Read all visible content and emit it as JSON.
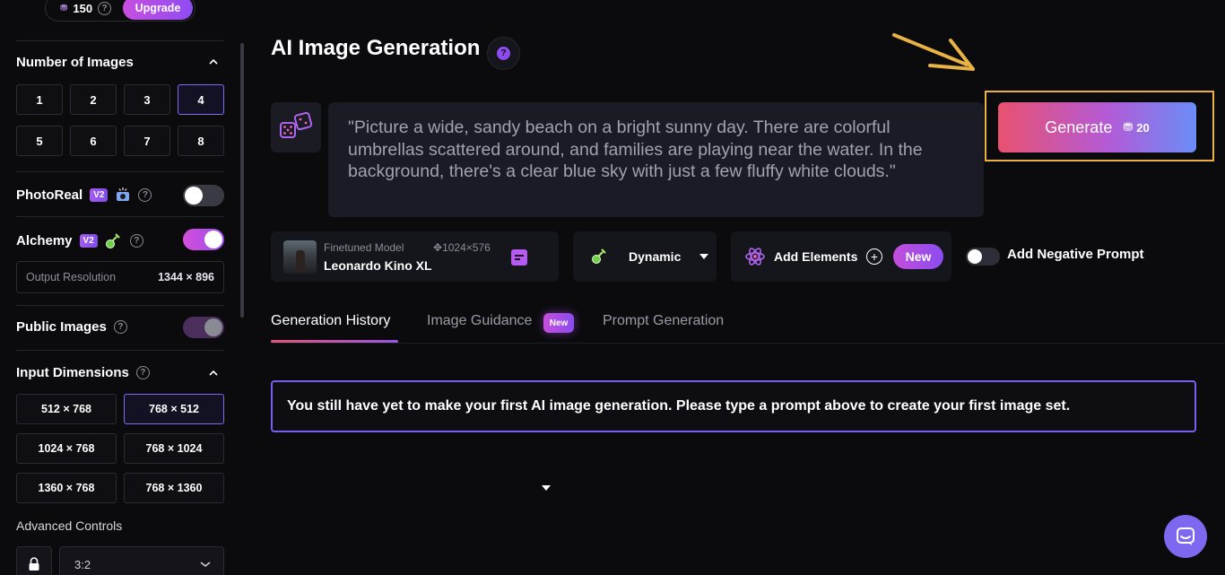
{
  "sidebar": {
    "credits": "150",
    "upgrade_label": "Upgrade",
    "number_of_images": {
      "title": "Number of Images",
      "options": [
        "1",
        "2",
        "3",
        "4",
        "5",
        "6",
        "7",
        "8"
      ],
      "selected": "4"
    },
    "photoreal": {
      "label": "PhotoReal",
      "badge": "V2",
      "enabled": false
    },
    "alchemy": {
      "label": "Alchemy",
      "badge": "V2",
      "enabled": true
    },
    "output_resolution": {
      "label": "Output Resolution",
      "value": "1344 × 896"
    },
    "public_images": {
      "label": "Public Images",
      "enabled": true
    },
    "input_dimensions": {
      "title": "Input Dimensions",
      "options": [
        "512 × 768",
        "768 × 512",
        "1024 × 768",
        "768 × 1024",
        "1360 × 768",
        "768 × 1360"
      ],
      "selected": "768 × 512"
    },
    "advanced_controls": {
      "label": "Advanced Controls",
      "aspect_ratio": "3:2"
    }
  },
  "main": {
    "title": "AI Image Generation",
    "prompt": " \"Picture a wide, sandy beach on a bright sunny day. There are colorful umbrellas scattered around, and families are playing near the water. In the background, there's a clear blue sky with just a few fluffy white clouds.\"",
    "generate": {
      "label": "Generate",
      "cost": "20"
    },
    "model": {
      "subtitle": "Finetuned Model",
      "name": "Leonardo Kino XL",
      "dimensions": "1024×576"
    },
    "style": {
      "label": "Dynamic"
    },
    "elements": {
      "label": "Add Elements",
      "badge": "New"
    },
    "negative_prompt": {
      "label": "Add Negative Prompt",
      "enabled": false
    },
    "tabs": [
      {
        "label": "Generation History",
        "active": true
      },
      {
        "label": "Image Guidance",
        "badge": "New"
      },
      {
        "label": "Prompt Generation"
      }
    ],
    "notice": "You still have yet to make your first AI image generation. Please type a prompt above to create your first image set."
  },
  "colors": {
    "accent_purple": "#8d4cf0",
    "highlight_outline": "#e9b245",
    "generate_gradient_start": "#e8516f",
    "generate_gradient_end": "#6a8df7"
  }
}
